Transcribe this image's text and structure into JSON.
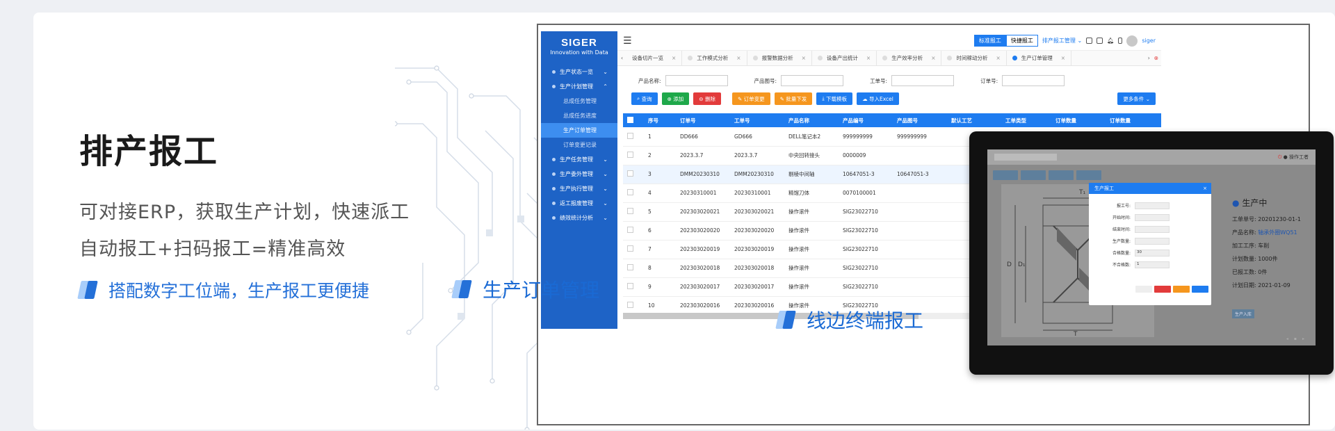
{
  "left": {
    "title": "排产报工",
    "line1": "可对接ERP，获取生产计划，快速派工",
    "line2": "自动报工+扫码报工=精准高效",
    "feature": "搭配数字工位端，生产报工更便捷"
  },
  "colors": {
    "accent": "#1e7cf0",
    "sidebar": "#1e63c6",
    "caption": "#1a6ad4"
  },
  "app": {
    "brand": "SIGER",
    "brand_sub": "Innovation with Data",
    "menu": [
      {
        "label": "生产状态一览",
        "type": "item"
      },
      {
        "label": "生产计划管理",
        "type": "item",
        "open": true
      },
      {
        "label": "总成任务管理",
        "type": "sub"
      },
      {
        "label": "总成任务进度",
        "type": "sub"
      },
      {
        "label": "生产订单管理",
        "type": "sub",
        "active": true
      },
      {
        "label": "订单变更记录",
        "type": "sub"
      },
      {
        "label": "生产任务管理",
        "type": "item"
      },
      {
        "label": "生产委外管理",
        "type": "item"
      },
      {
        "label": "生产执行管理",
        "type": "item"
      },
      {
        "label": "返工报废管理",
        "type": "item"
      },
      {
        "label": "绩效统计分析",
        "type": "item"
      }
    ],
    "topbar": {
      "mode_std": "标准报工",
      "mode_fast": "快捷报工",
      "module": "排产报工管理",
      "user": "siger"
    },
    "tabs": [
      "设备切片一览",
      "工作模式分析",
      "报警数据分析",
      "设备产出统计",
      "生产效率分析",
      "时间稼动分析",
      "生产订单管理"
    ],
    "filters": [
      {
        "label": "产品名称:"
      },
      {
        "label": "产品图号:"
      },
      {
        "label": "工单号:"
      },
      {
        "label": "订单号:"
      }
    ],
    "actions": [
      {
        "label": "查询",
        "color": "#1e7cf0"
      },
      {
        "label": "添加",
        "color": "#1ea84a"
      },
      {
        "label": "删除",
        "color": "#e23b3b"
      },
      {
        "label": "订单变更",
        "color": "#f5961e"
      },
      {
        "label": "批量下发",
        "color": "#f5961e"
      },
      {
        "label": "下载模板",
        "color": "#1e7cf0"
      },
      {
        "label": "导入Excel",
        "color": "#1e7cf0"
      }
    ],
    "more": "更多条件",
    "table": {
      "columns": [
        "序号",
        "订单号",
        "工单号",
        "产品名称",
        "产品编号",
        "产品图号",
        "默认工艺",
        "工单类型",
        "订单数量",
        "订单数量"
      ],
      "rows": [
        [
          "1",
          "DD666",
          "GD666",
          "DELL笔记本2",
          "999999999",
          "999999999"
        ],
        [
          "2",
          "2023.3.7",
          "2023.3.7",
          "中央回转接头",
          "0000009",
          ""
        ],
        [
          "3",
          "DMM20230310",
          "DMM20230310",
          "剔棱中间轴",
          "10647051-3",
          "10647051-3"
        ],
        [
          "4",
          "20230310001",
          "20230310001",
          "精馏刀体",
          "0070100001",
          ""
        ],
        [
          "5",
          "202303020021",
          "202303020021",
          "操作滚件",
          "SIG23022710",
          ""
        ],
        [
          "6",
          "202303020020",
          "202303020020",
          "操作滚件",
          "SIG23022710",
          ""
        ],
        [
          "7",
          "202303020019",
          "202303020019",
          "操作滚件",
          "SIG23022710",
          ""
        ],
        [
          "8",
          "202303020018",
          "202303020018",
          "操作滚件",
          "SIG23022710",
          ""
        ],
        [
          "9",
          "202303020017",
          "202303020017",
          "操作滚件",
          "SIG23022710",
          ""
        ],
        [
          "10",
          "202303020016",
          "202303020016",
          "操作滚件",
          "SIG23022710",
          ""
        ]
      ]
    }
  },
  "tablet": {
    "title": "生产报工",
    "user": "操作工者",
    "fields": [
      "报工号:",
      "开始时间:",
      "结束时间:",
      "生产数量:",
      "合格数量:",
      "不合格数:"
    ],
    "field_values": [
      "",
      "",
      "",
      "",
      "30",
      "1"
    ],
    "status_title": "生产中",
    "status_lines": [
      {
        "label": "工单单号: ",
        "value": "20201230-01-1"
      },
      {
        "label": "产品名称: ",
        "value": "轴承外圈WQ51",
        "link": true
      },
      {
        "label": "加工工序: ",
        "value": "车削"
      },
      {
        "label": "计划数量: ",
        "value": "1000件"
      },
      {
        "label": "已报工数: ",
        "value": "0件"
      },
      {
        "label": "计划日期: ",
        "value": "2021-01-09"
      }
    ],
    "status_btn": "生产入库"
  },
  "captions": {
    "order": "生产订单管理",
    "terminal": "线边终端报工"
  }
}
